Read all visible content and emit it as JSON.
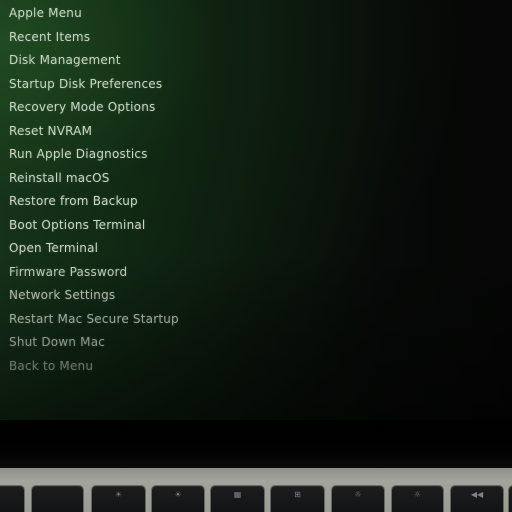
{
  "screen": {
    "menu_items": [
      "Apple Menu",
      "Recent Items",
      "Disk Management",
      "Startup Disk Preferences",
      "Recovery Mode Options",
      "Reset NVRAM",
      "Run Apple Diagnostics",
      "Reinstall macOS",
      "Restore from Backup",
      "Boot Options Terminal",
      "Open Terminal",
      "Firmware Password",
      "Network Settings",
      "Restart Mac Secure Startup",
      "Shut Down Mac",
      "Back to Menu"
    ]
  },
  "keyboard": {
    "keys": [
      {
        "glyph": ""
      },
      {
        "glyph": ""
      },
      {
        "glyph": "☀"
      },
      {
        "glyph": "☀"
      },
      {
        "glyph": "▦"
      },
      {
        "glyph": "⊞"
      },
      {
        "glyph": "☼"
      },
      {
        "glyph": "☼"
      },
      {
        "glyph": "◀◀"
      },
      {
        "glyph": "▶▶"
      }
    ]
  },
  "colors": {
    "screen_glow": "#16331a",
    "menu_text": "#c8d4c4",
    "keyboard_deck": "#a3a49d",
    "key_cap": "#151618"
  }
}
